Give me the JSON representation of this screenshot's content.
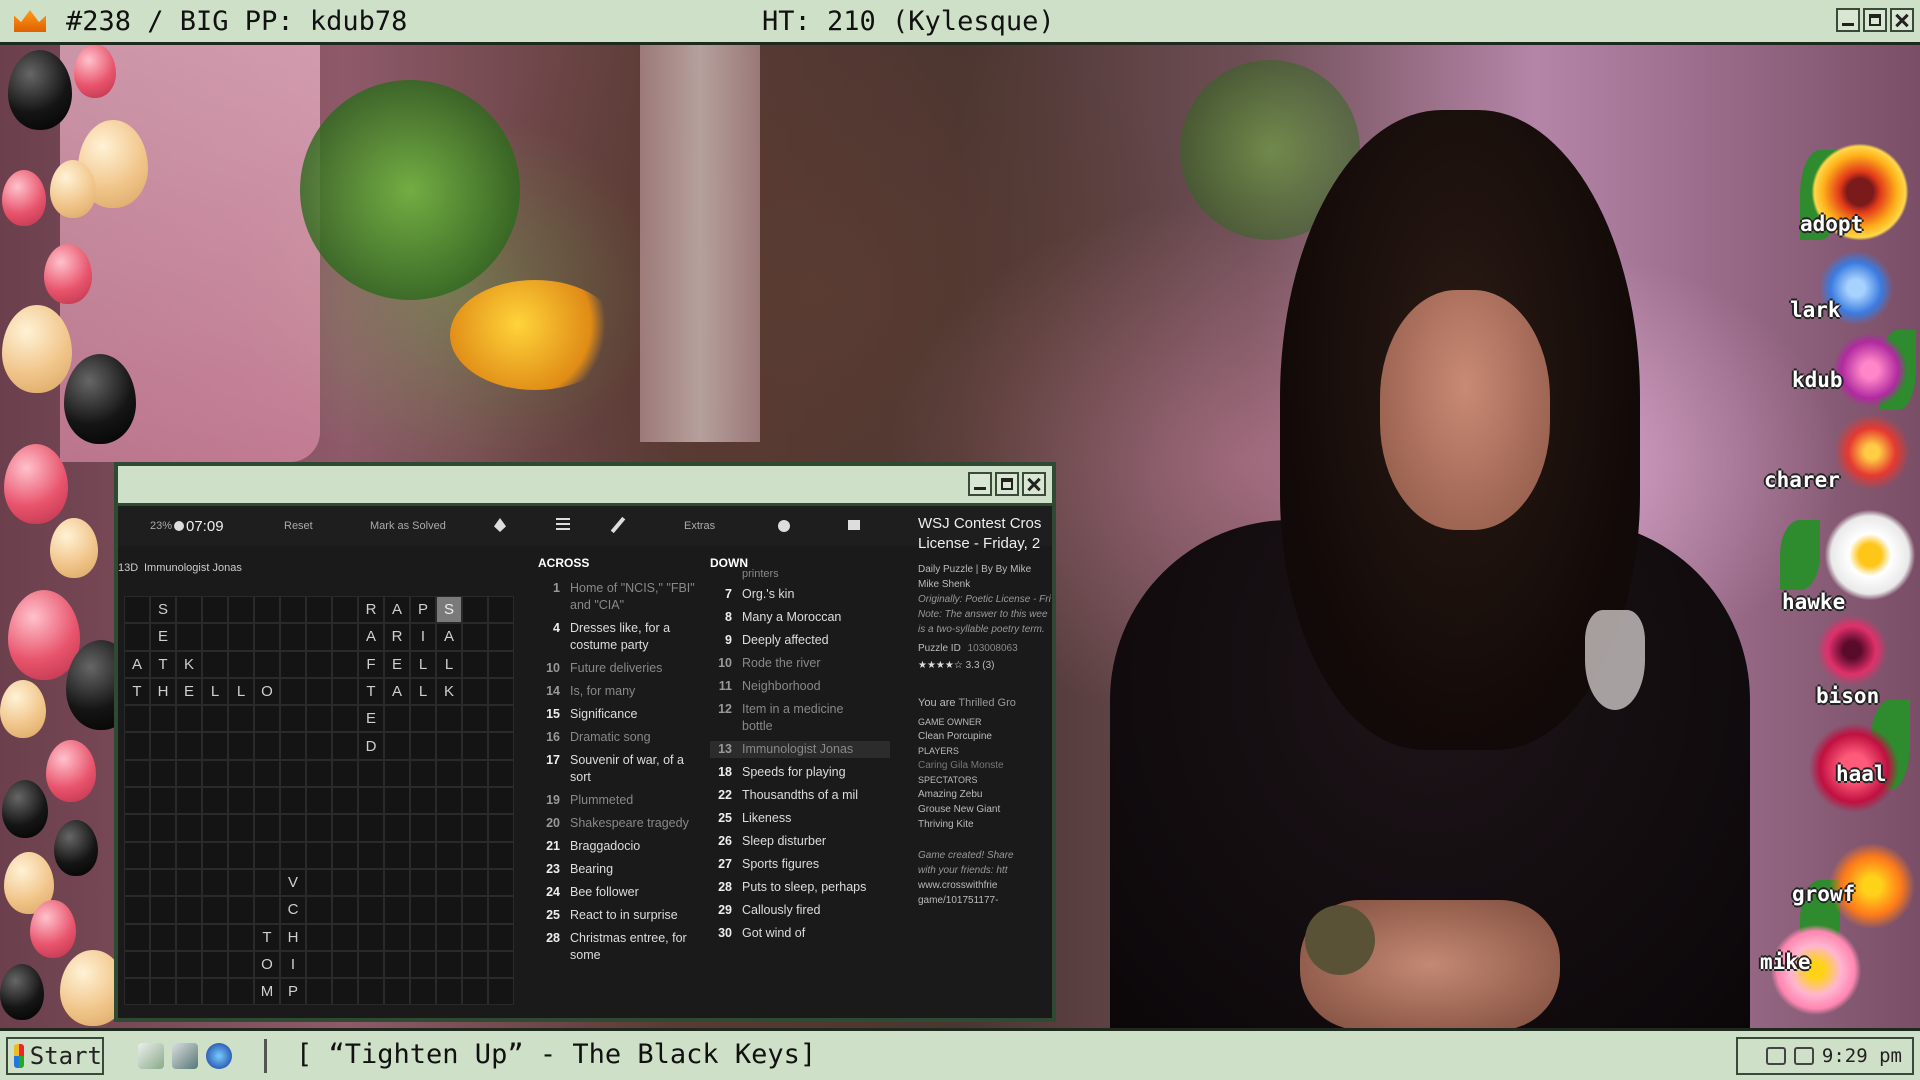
{
  "topbar": {
    "left_text": "#238 / BIG PP: kdub78",
    "center_text": "HT: 210 (Kylesque)",
    "crown_icon": "crown-icon",
    "bg": "#cfe0c8"
  },
  "chat_flowers": {
    "names": [
      "adopt",
      "lark",
      "kdub",
      "charer",
      "hawke",
      "bison",
      "haal",
      "growf",
      "mike"
    ]
  },
  "crossword": {
    "toolbar": {
      "percent": "23%",
      "timer": "07:09",
      "reset": "Reset",
      "mark_solved": "Mark as Solved",
      "extras": "Extras"
    },
    "current_clue": {
      "num": "13D",
      "text": "Immunologist Jonas"
    },
    "grid_rows": [
      [
        "",
        "S",
        "",
        "",
        "",
        "",
        "",
        "",
        "",
        "R",
        "A",
        "P",
        "S",
        "",
        ""
      ],
      [
        "",
        "E",
        "",
        "",
        "",
        "",
        "",
        "",
        "",
        "A",
        "R",
        "I",
        "A",
        "",
        ""
      ],
      [
        "A",
        "T",
        "K",
        "",
        "",
        "",
        "",
        "",
        "",
        "F",
        "E",
        "L",
        "L",
        "",
        ""
      ],
      [
        "T",
        "H",
        "E",
        "L",
        "L",
        "O",
        "",
        "",
        "",
        "T",
        "A",
        "L",
        "K",
        "",
        ""
      ],
      [
        "",
        "",
        "",
        "",
        "",
        "",
        "",
        "",
        "",
        "E",
        "",
        "",
        "",
        "",
        ""
      ],
      [
        "",
        "",
        "",
        "",
        "",
        "",
        "",
        "",
        "",
        "D",
        "",
        "",
        "",
        "",
        ""
      ],
      [
        "",
        "",
        "",
        "",
        "",
        "",
        "",
        "",
        "",
        "",
        "",
        "",
        "",
        "",
        ""
      ],
      [
        "",
        "",
        "",
        "",
        "",
        "",
        "",
        "",
        "",
        "",
        "",
        "",
        "",
        "",
        ""
      ],
      [
        "",
        "",
        "",
        "",
        "",
        "",
        "",
        "",
        "",
        "",
        "",
        "",
        "",
        "",
        ""
      ],
      [
        "",
        "",
        "",
        "",
        "",
        "",
        "",
        "",
        "",
        "",
        "",
        "",
        "",
        "",
        ""
      ],
      [
        "",
        "",
        "",
        "",
        "",
        "",
        "V",
        "",
        "",
        "",
        "",
        "",
        "",
        "",
        ""
      ],
      [
        "",
        "",
        "",
        "",
        "",
        "",
        "C",
        "",
        "",
        "",
        "",
        "",
        "",
        "",
        ""
      ],
      [
        "",
        "",
        "",
        "",
        "",
        "T",
        "H",
        "",
        "",
        "",
        "",
        "",
        "",
        "",
        ""
      ],
      [
        "",
        "",
        "",
        "",
        "",
        "O",
        "I",
        "",
        "",
        "",
        "",
        "",
        "",
        "",
        ""
      ],
      [
        "",
        "",
        "",
        "",
        "",
        "M",
        "P",
        "",
        "",
        "",
        "",
        "",
        "",
        "",
        ""
      ]
    ],
    "across_label": "ACROSS",
    "across": [
      {
        "n": "1",
        "t": "Home of \"NCIS,\" \"FBI\" and \"CIA\"",
        "dim": true
      },
      {
        "n": "4",
        "t": "Dresses like, for a costume party",
        "dim": false
      },
      {
        "n": "10",
        "t": "Future deliveries",
        "dim": true
      },
      {
        "n": "14",
        "t": "Is, for many",
        "dim": true
      },
      {
        "n": "15",
        "t": "Significance",
        "dim": false
      },
      {
        "n": "16",
        "t": "Dramatic song",
        "dim": true
      },
      {
        "n": "17",
        "t": "Souvenir of war, of a sort",
        "dim": false
      },
      {
        "n": "19",
        "t": "Plummeted",
        "dim": true
      },
      {
        "n": "20",
        "t": "Shakespeare tragedy",
        "dim": true
      },
      {
        "n": "21",
        "t": "Braggadocio",
        "dim": false
      },
      {
        "n": "23",
        "t": "Bearing",
        "dim": false
      },
      {
        "n": "24",
        "t": "Bee follower",
        "dim": false
      },
      {
        "n": "25",
        "t": "React to in surprise",
        "dim": false
      },
      {
        "n": "28",
        "t": "Christmas entree, for some",
        "dim": false
      }
    ],
    "down_label": "DOWN",
    "down_partial_top": "printers",
    "down": [
      {
        "n": "7",
        "t": "Org.'s kin",
        "dim": false
      },
      {
        "n": "8",
        "t": "Many a Moroccan",
        "dim": false
      },
      {
        "n": "9",
        "t": "Deeply affected",
        "dim": false
      },
      {
        "n": "10",
        "t": "Rode the river",
        "dim": true
      },
      {
        "n": "11",
        "t": "Neighborhood",
        "dim": true
      },
      {
        "n": "12",
        "t": "Item in a medicine bottle",
        "dim": true
      },
      {
        "n": "13",
        "t": "Immunologist Jonas",
        "dim": true,
        "sel": true
      },
      {
        "n": "18",
        "t": "Speeds for playing",
        "dim": false
      },
      {
        "n": "22",
        "t": "Thousandths of a mil",
        "dim": false
      },
      {
        "n": "25",
        "t": "Likeness",
        "dim": false
      },
      {
        "n": "26",
        "t": "Sleep disturber",
        "dim": false
      },
      {
        "n": "27",
        "t": "Sports figures",
        "dim": false
      },
      {
        "n": "28",
        "t": "Puts to sleep, perhaps",
        "dim": false
      },
      {
        "n": "29",
        "t": "Callously fired",
        "dim": false
      },
      {
        "n": "30",
        "t": "Got wind of",
        "dim": false
      }
    ],
    "side": {
      "title_l1": "WSJ Contest Cros",
      "title_l2": "License - Friday, 2",
      "byline_l1": "Daily Puzzle | By By Mike",
      "byline_l2": "Mike Shenk",
      "original": "Originally: Poetic License - Fri",
      "note_l1": "Note: The answer to this wee",
      "note_l2": "is a two-syllable poetry term.",
      "puzzle_id_label": "Puzzle ID",
      "puzzle_id": "103008063",
      "rating": "3.3 (3)",
      "you_are_label": "You are",
      "you_are": "Thrilled Gro",
      "game_owner_label": "GAME OWNER",
      "game_owner": "Clean Porcupine",
      "players_label": "PLAYERS",
      "players": "Caring Gila Monste",
      "spectators_label": "SPECTATORS",
      "spectators_l1": "Amazing Zebu",
      "spectators_l2": "Grouse  New Giant",
      "spectators_l3": "Thriving Kite",
      "created_l1": "Game created! Share",
      "created_l2": "with your friends: htt",
      "created_l3": "www.crosswithfrie",
      "created_l4": "game/101751177-"
    }
  },
  "taskbar": {
    "start_label": "Start",
    "now_playing": "[ “Tighten Up” - The Black Keys]",
    "clock": "9:29 pm"
  }
}
